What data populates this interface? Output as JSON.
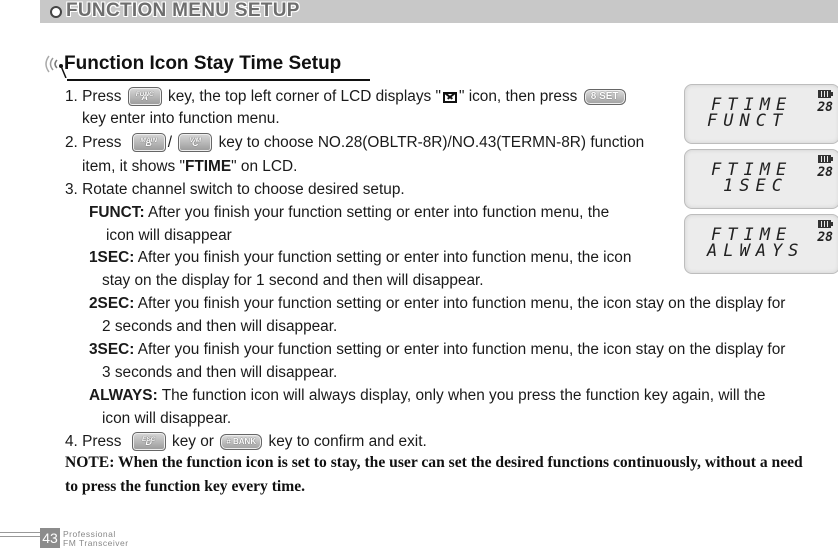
{
  "header": {
    "title": "FUNCTION MENU SETUP"
  },
  "section": {
    "title": "Function Icon Stay Time Setup"
  },
  "keys": {
    "a": {
      "main": "A",
      "sub": "FUNC"
    },
    "b": {
      "main": "B",
      "sub": "MAIN"
    },
    "c": {
      "main": "C",
      "sub": "V/M"
    },
    "d": {
      "main": "D",
      "sub": "ESC"
    },
    "set": "8 SET",
    "bank": "# BANK"
  },
  "steps": {
    "s1_a": "1. Press",
    "s1_b": "key, the top left corner of LCD displays \"",
    "s1_c": "\" icon, then press",
    "s1_d": "key enter into function menu.",
    "s2_a": "2. Press",
    "s2_sep": "/",
    "s2_b": "key to choose NO.28(OBLTR-8R)/NO.43(TERMN-8R) function",
    "s2_c1": "item, it shows \"",
    "s2_c2": "FTIME",
    "s2_c3": "\" on LCD.",
    "s3": "3. Rotate channel switch to choose desired setup.",
    "s4_a": "4. Press",
    "s4_b": "key or",
    "s4_c": "key to confirm and exit."
  },
  "options": [
    {
      "label": "FUNCT:",
      "line1": " After you finish your function setting or enter into function menu, the",
      "line2": "icon will disappear"
    },
    {
      "label": "1SEC:",
      "line1": " After you finish your function setting or enter into function menu, the icon",
      "line2": "stay on the display for 1 second and then will disappear."
    },
    {
      "label": "2SEC:",
      "line1": " After you finish your function setting or enter into function menu, the icon stay on the display for",
      "line2": "2 seconds and then will disappear."
    },
    {
      "label": "3SEC:",
      "line1": " After you finish your function setting or enter into function menu, the icon stay on the display for",
      "line2": "3 seconds and then will disappear."
    },
    {
      "label": "ALWAYS:",
      "line1": " The function icon will always display, only when you press the function key again, will the",
      "line2": "icon will disappear."
    }
  ],
  "note": {
    "line1": "NOTE: When the function icon is set to stay, the user can set the desired functions continuously, without a need",
    "line2": "to press the function key every time."
  },
  "lcd_panels": [
    {
      "line1": "FTIME",
      "line2": "FUNCT",
      "channel": "28"
    },
    {
      "line1": "FTIME",
      "line2": "1SEC",
      "channel": "28"
    },
    {
      "line1": "FTIME",
      "line2": "ALWAYS",
      "channel": "28"
    }
  ],
  "footer": {
    "page": "43",
    "line1": "Professional",
    "line2": "FM Transceiver"
  }
}
